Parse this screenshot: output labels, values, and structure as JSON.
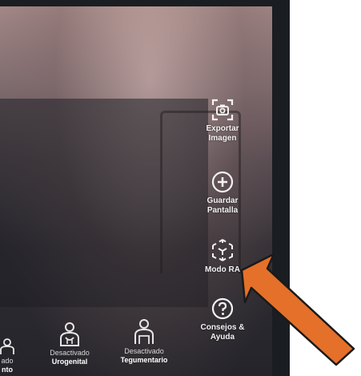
{
  "screen": {
    "side_tools": [
      {
        "icon": "camera-frame-icon",
        "label_line1": "Exportar",
        "label_line2": "Imagen"
      },
      {
        "icon": "plus-circle-icon",
        "label_line1": "Guardar",
        "label_line2": "Pantalla"
      },
      {
        "icon": "ar-cube-icon",
        "label_line1": "Modo RA",
        "label_line2": ""
      },
      {
        "icon": "help-circle-icon",
        "label_line1": "Consejos &",
        "label_line2": "Ayuda"
      }
    ],
    "systems": [
      {
        "status": "ado",
        "name": "nto"
      },
      {
        "status": "Desactivado",
        "name": "Urogenital"
      },
      {
        "status": "Desactivado",
        "name": "Tegumentario"
      }
    ]
  },
  "annotation": {
    "arrow_color": "#e5702a",
    "arrow_outline": "#1a1a1a"
  }
}
